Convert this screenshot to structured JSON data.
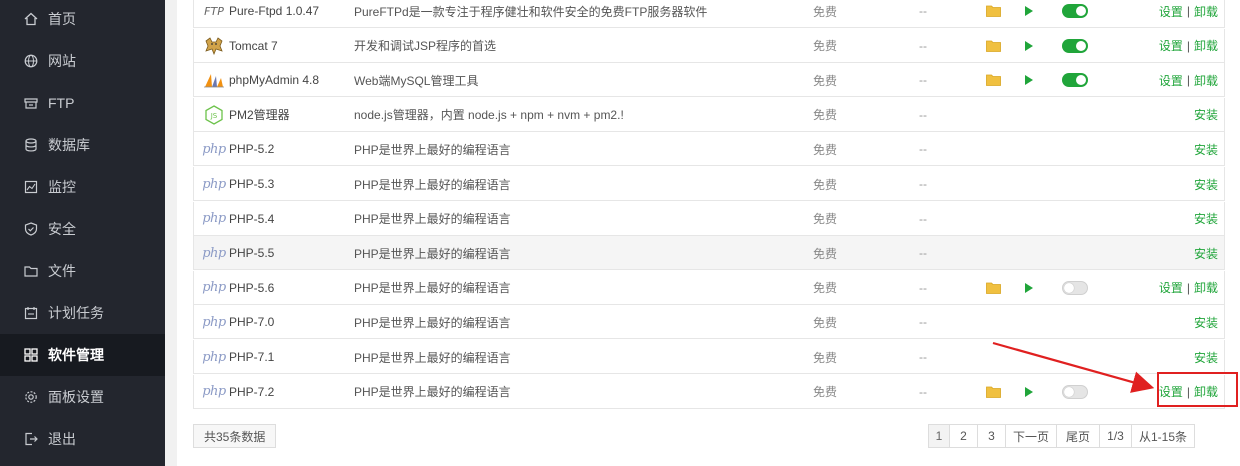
{
  "sidebar": {
    "items": [
      {
        "label": "首页",
        "icon": "home-icon"
      },
      {
        "label": "网站",
        "icon": "globe-icon"
      },
      {
        "label": "FTP",
        "icon": "ftp-icon"
      },
      {
        "label": "数据库",
        "icon": "database-icon"
      },
      {
        "label": "监控",
        "icon": "monitor-icon"
      },
      {
        "label": "安全",
        "icon": "shield-icon"
      },
      {
        "label": "文件",
        "icon": "folder-icon"
      },
      {
        "label": "计划任务",
        "icon": "calendar-icon"
      },
      {
        "label": "软件管理",
        "icon": "grid-icon",
        "active": true
      },
      {
        "label": "面板设置",
        "icon": "gear-icon"
      },
      {
        "label": "退出",
        "icon": "logout-icon"
      }
    ]
  },
  "software": {
    "rows": [
      {
        "logo_text": "FTP",
        "name": "Pure-Ftpd 1.0.47",
        "desc": "PureFTPd是一款专注于程序健壮和软件安全的免费FTP服务器软件",
        "price": "免费",
        "expire": "--",
        "installed": true,
        "running": true,
        "op1": "设置",
        "op_sep": "|",
        "op2": "卸载"
      },
      {
        "logo_text": "",
        "name": "Tomcat 7",
        "desc": "开发和调试JSP程序的首选",
        "price": "免费",
        "expire": "--",
        "installed": true,
        "running": true,
        "op1": "设置",
        "op_sep": "|",
        "op2": "卸载"
      },
      {
        "logo_text": "",
        "name": "phpMyAdmin 4.8",
        "desc": "Web端MySQL管理工具",
        "price": "免费",
        "expire": "--",
        "installed": true,
        "running": true,
        "op1": "设置",
        "op_sep": "|",
        "op2": "卸载"
      },
      {
        "logo_text": "JS",
        "name": "PM2管理器",
        "desc": "node.js管理器，内置 node.js + npm + nvm + pm2.!",
        "price": "免费",
        "expire": "--",
        "installed": false,
        "op1": "安装"
      },
      {
        "logo_text": "php",
        "name": "PHP-5.2",
        "desc": "PHP是世界上最好的编程语言",
        "price": "免费",
        "expire": "--",
        "installed": false,
        "op1": "安装"
      },
      {
        "logo_text": "php",
        "name": "PHP-5.3",
        "desc": "PHP是世界上最好的编程语言",
        "price": "免费",
        "expire": "--",
        "installed": false,
        "op1": "安装"
      },
      {
        "logo_text": "php",
        "name": "PHP-5.4",
        "desc": "PHP是世界上最好的编程语言",
        "price": "免费",
        "expire": "--",
        "installed": false,
        "op1": "安装"
      },
      {
        "logo_text": "php",
        "name": "PHP-5.5",
        "desc": "PHP是世界上最好的编程语言",
        "price": "免费",
        "expire": "--",
        "installed": false,
        "op1": "安装"
      },
      {
        "logo_text": "php",
        "name": "PHP-5.6",
        "desc": "PHP是世界上最好的编程语言",
        "price": "免费",
        "expire": "--",
        "installed": true,
        "running": false,
        "op1": "设置",
        "op_sep": "|",
        "op2": "卸载"
      },
      {
        "logo_text": "php",
        "name": "PHP-7.0",
        "desc": "PHP是世界上最好的编程语言",
        "price": "免费",
        "expire": "--",
        "installed": false,
        "op1": "安装"
      },
      {
        "logo_text": "php",
        "name": "PHP-7.1",
        "desc": "PHP是世界上最好的编程语言",
        "price": "免费",
        "expire": "--",
        "installed": false,
        "op1": "安装"
      },
      {
        "logo_text": "php",
        "name": "PHP-7.2",
        "desc": "PHP是世界上最好的编程语言",
        "price": "免费",
        "expire": "--",
        "installed": true,
        "running": false,
        "op1": "设置",
        "op_sep": "|",
        "op2": "卸载"
      }
    ]
  },
  "footer": {
    "total": "共35条数据",
    "pages": [
      "1",
      "2",
      "3",
      "下一页",
      "尾页",
      "1/3",
      "从1-15条"
    ],
    "current_page": "1"
  },
  "colors": {
    "accent": "#20a53a",
    "sidebar_bg": "#23262e",
    "annotation": "#e02020"
  }
}
